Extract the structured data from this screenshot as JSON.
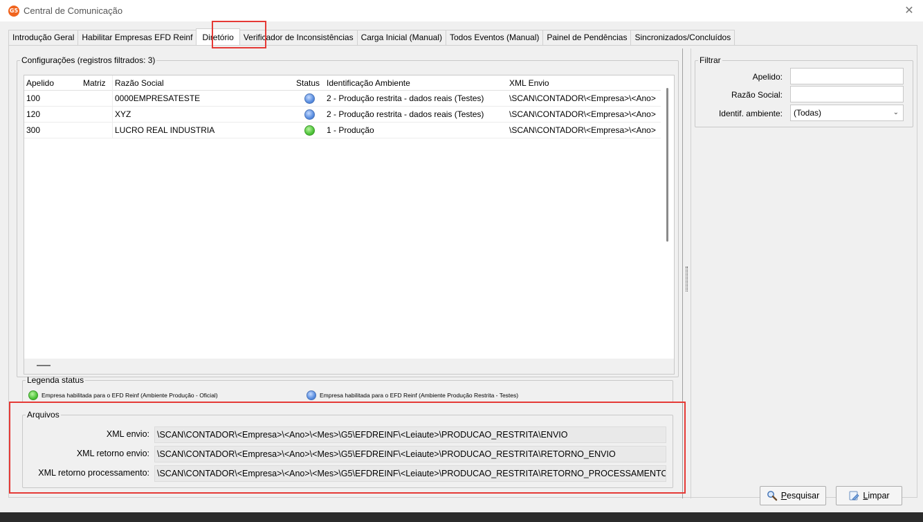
{
  "window": {
    "title": "Central de Comunicação",
    "icon_text": "G5"
  },
  "tabs": [
    {
      "label": "Introdução Geral"
    },
    {
      "label": "Habilitar Empresas EFD Reinf"
    },
    {
      "label": "Diretório"
    },
    {
      "label": "Verificador de Inconsistências"
    },
    {
      "label": "Carga Inicial (Manual)"
    },
    {
      "label": "Todos Eventos (Manual)"
    },
    {
      "label": "Painel de Pendências"
    },
    {
      "label": "Sincronizados/Concluídos"
    }
  ],
  "config": {
    "group_title": "Configurações (registros filtrados: 3)",
    "columns": {
      "apelido": "Apelido",
      "matriz": "Matriz",
      "razao": "Razão Social",
      "status": "Status",
      "ident": "Identificação Ambiente",
      "xml": "XML Envio"
    },
    "rows": [
      {
        "apelido": "100",
        "matriz": "",
        "razao": "0000EMPRESATESTE",
        "status": "blue",
        "ident": "2 - Produção restrita - dados reais (Testes)",
        "xml": "\\SCAN\\CONTADOR\\<Empresa>\\<Ano>"
      },
      {
        "apelido": "120",
        "matriz": "",
        "razao": "XYZ",
        "status": "blue",
        "ident": "2 - Produção restrita - dados reais (Testes)",
        "xml": "\\SCAN\\CONTADOR\\<Empresa>\\<Ano>"
      },
      {
        "apelido": "300",
        "matriz": "",
        "razao": "LUCRO REAL INDUSTRIA",
        "status": "green",
        "ident": "1 - Produção",
        "xml": "\\SCAN\\CONTADOR\\<Empresa>\\<Ano>"
      }
    ]
  },
  "legend": {
    "title": "Legenda status",
    "green_text": "Empresa habilitada para o EFD Reinf (Ambiente Produção - Oficial)",
    "blue_text": "Empresa habilitada para o EFD Reinf (Ambiente Produção Restrita - Testes)"
  },
  "arquivos": {
    "title": "Arquivos",
    "xml_envio_label": "XML envio:",
    "xml_envio_value": "\\SCAN\\CONTADOR\\<Empresa>\\<Ano>\\<Mes>\\G5\\EFDREINF\\<Leiaute>\\PRODUCAO_RESTRITA\\ENVIO",
    "xml_retorno_envio_label": "XML retorno envio:",
    "xml_retorno_envio_value": "\\SCAN\\CONTADOR\\<Empresa>\\<Ano>\\<Mes>\\G5\\EFDREINF\\<Leiaute>\\PRODUCAO_RESTRITA\\RETORNO_ENVIO",
    "xml_retorno_proc_label": "XML retorno processamento:",
    "xml_retorno_proc_value": "\\SCAN\\CONTADOR\\<Empresa>\\<Ano>\\<Mes>\\G5\\EFDREINF\\<Leiaute>\\PRODUCAO_RESTRITA\\RETORNO_PROCESSAMENTO"
  },
  "filter": {
    "title": "Filtrar",
    "apelido_label": "Apelido:",
    "apelido_value": "",
    "razao_label": "Razão Social:",
    "razao_value": "",
    "ambiente_label": "Identif. ambiente:",
    "ambiente_value": "(Todas)"
  },
  "buttons": {
    "pesquisar_rest": "esquisar",
    "pesquisar_key": "P",
    "limpar_rest": "impar",
    "limpar_key": "L"
  },
  "colors": {
    "highlight_red": "#e53935",
    "status_blue": "#5a8ee0",
    "status_green": "#4fc43a",
    "app_icon": "#f0641e"
  },
  "icons": {
    "status_blue": "blue-circle",
    "status_green": "green-circle",
    "pesquisar": "magnifier",
    "limpar": "eraser",
    "close": "close-x"
  }
}
